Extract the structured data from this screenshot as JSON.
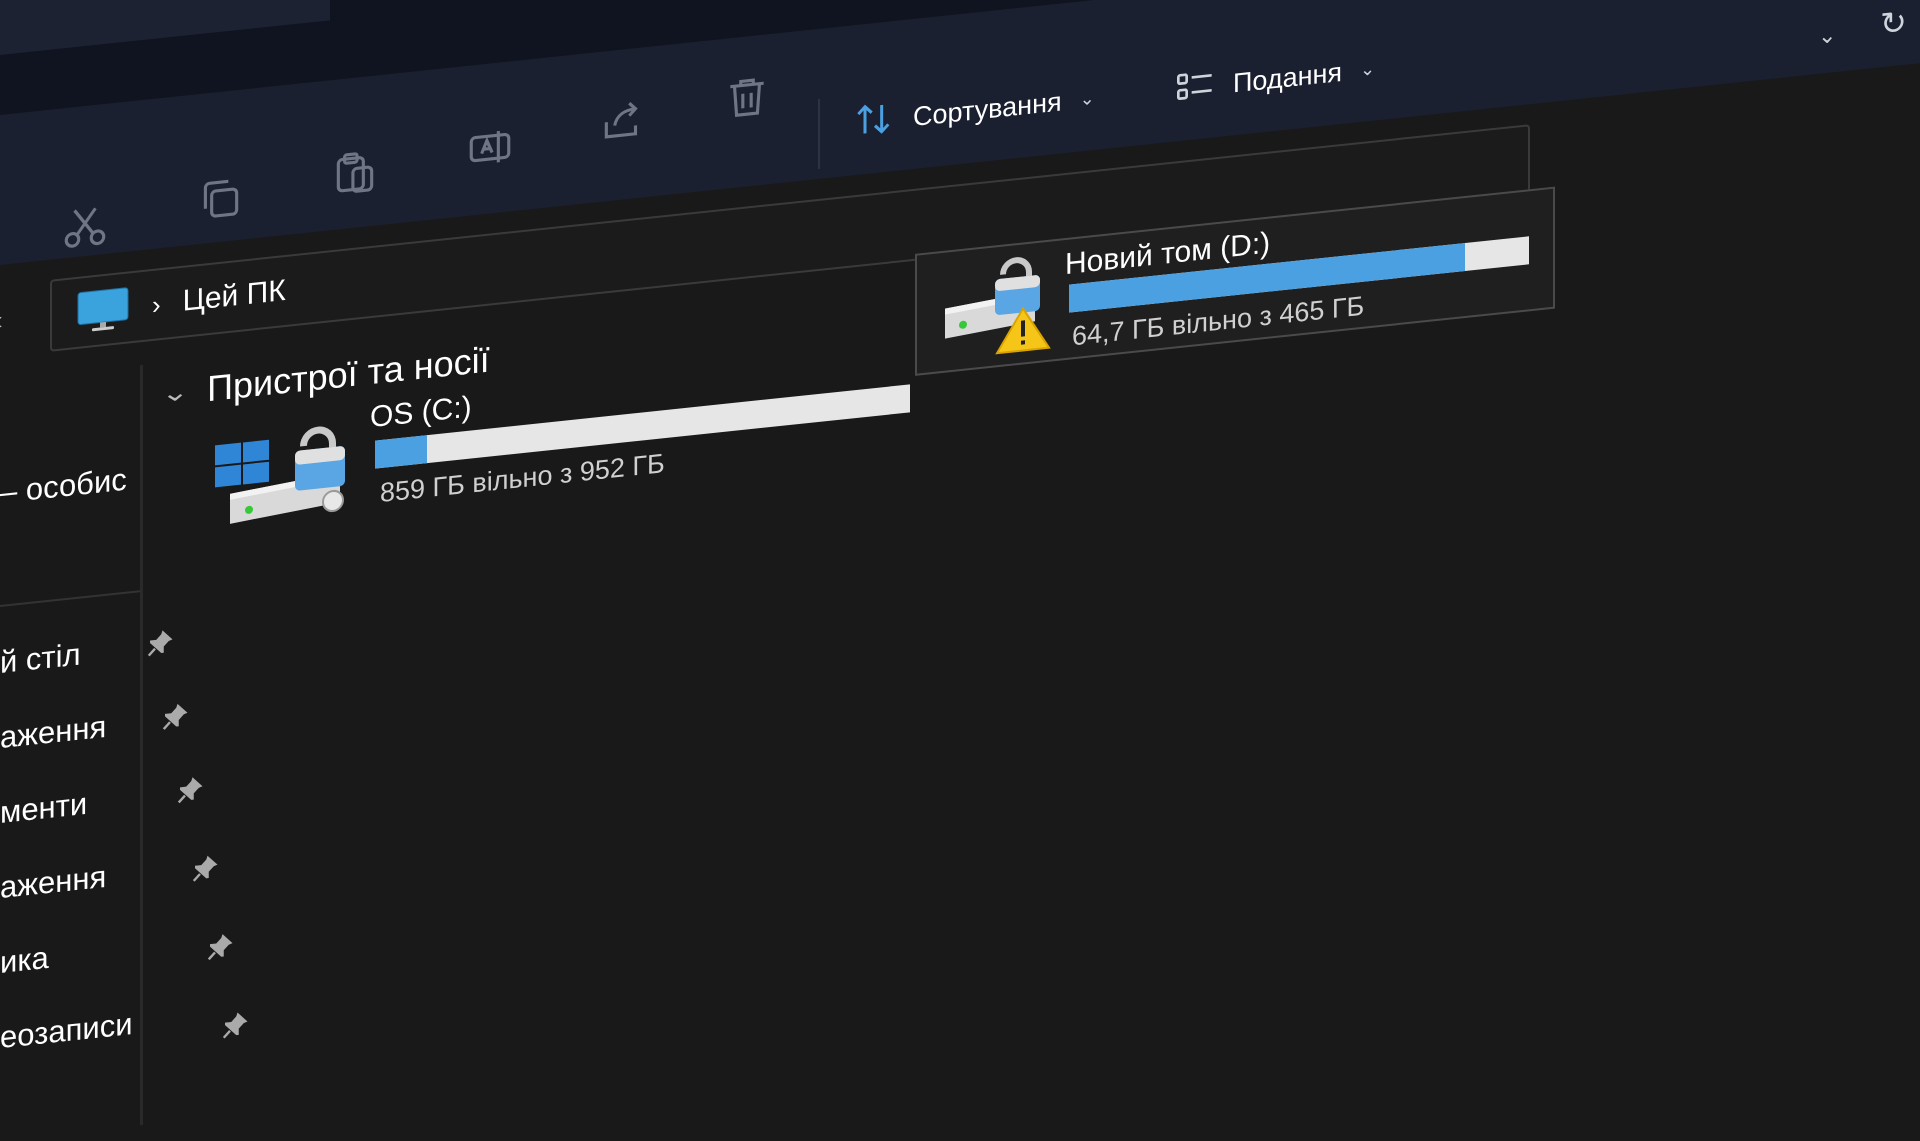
{
  "window": {
    "new_tab_glyph": "+",
    "close_tab_glyph": "✕"
  },
  "toolbar": {
    "icons": [
      "cut-icon",
      "copy-icon",
      "paste-icon",
      "rename-icon",
      "share-icon",
      "delete-icon"
    ],
    "sort_label": "Сортування",
    "view_label": "Подання",
    "accent": "#4aa0e0"
  },
  "address": {
    "breadcrumb": [
      "Цей ПК"
    ],
    "separator": "›"
  },
  "sidebar": {
    "top_item": "– особис",
    "items": [
      {
        "label": "й стіл",
        "pinned": true
      },
      {
        "label": "аження",
        "pinned": true
      },
      {
        "label": "менти",
        "pinned": true
      },
      {
        "label": "аження",
        "pinned": true
      },
      {
        "label": "ика",
        "pinned": true
      },
      {
        "label": "еозаписи",
        "pinned": true
      }
    ]
  },
  "section": {
    "title": "Пристрої та носії"
  },
  "drives": [
    {
      "name": "OS (C:)",
      "free_text": "859 ГБ вільно з 952 ГБ",
      "used_fraction": 0.098,
      "warning": false,
      "icon": "windows-drive-lock-icon"
    },
    {
      "name": "Новий том (D:)",
      "free_text": "64,7 ГБ вільно з 465 ГБ",
      "used_fraction": 0.861,
      "warning": true,
      "icon": "drive-lock-warning-icon"
    }
  ],
  "colors": {
    "background": "#191919",
    "commandbar": "#1b2030",
    "bar_fill": "#4aa0e0",
    "bar_track": "#e6e6e6",
    "warning": "#f5c518"
  }
}
